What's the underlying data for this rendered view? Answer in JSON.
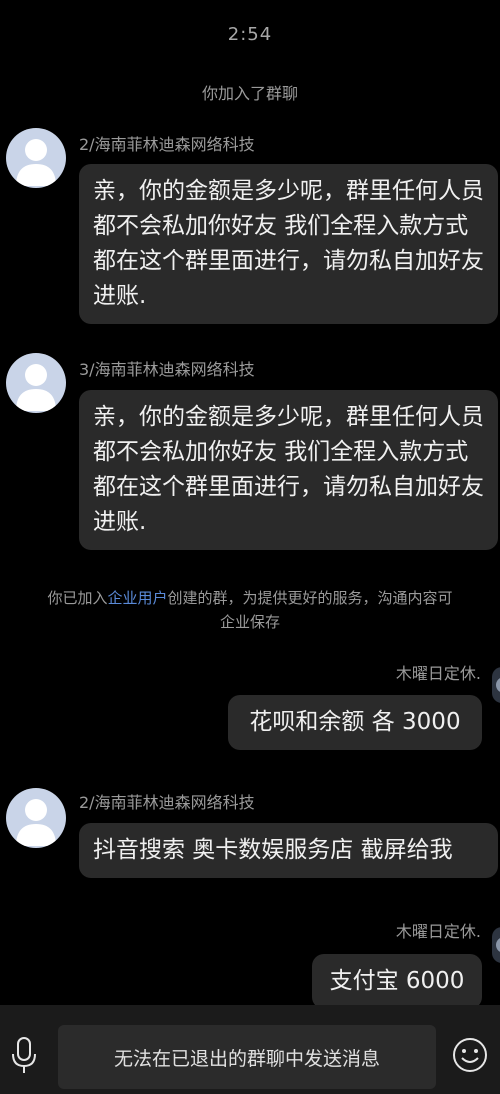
{
  "status": {
    "time": "2:54"
  },
  "system": {
    "joined": "你加入了群聊",
    "enterprise_prefix": "你已加入",
    "enterprise_link": "企业用户",
    "enterprise_suffix": "创建的群，为提供更好的服务，沟通内容可",
    "enterprise_line2": "企业保存"
  },
  "messages": [
    {
      "sender": "2/海南菲林迪森网络科技",
      "text": "亲，你的金额是多少呢，群里任何人员都不会私加你好友 我们全程入款方式都在这个群里面进行，请勿私自加好友进账."
    },
    {
      "sender": "3/海南菲林迪森网络科技",
      "text": "亲，你的金额是多少呢，群里任何人员都不会私加你好友 我们全程入款方式都在这个群里面进行，请勿私自加好友进账."
    },
    {
      "sender": "木曜日定休.",
      "text": "花呗和余额 各 3000"
    },
    {
      "sender": "2/海南菲林迪森网络科技",
      "text": "抖音搜索 奥卡数娱服务店 截屏给我"
    },
    {
      "sender": "木曜日定休.",
      "text": "支付宝 6000"
    }
  ],
  "input_bar": {
    "disabled_text": "无法在已退出的群聊中发送消息",
    "left_icon": "microphone-icon",
    "right_icon": "emoji-icon"
  },
  "colors": {
    "background": "#000000",
    "bubble": "#2a2a2a",
    "link": "#5a8ad8",
    "avatar": "#c9d4e8"
  }
}
